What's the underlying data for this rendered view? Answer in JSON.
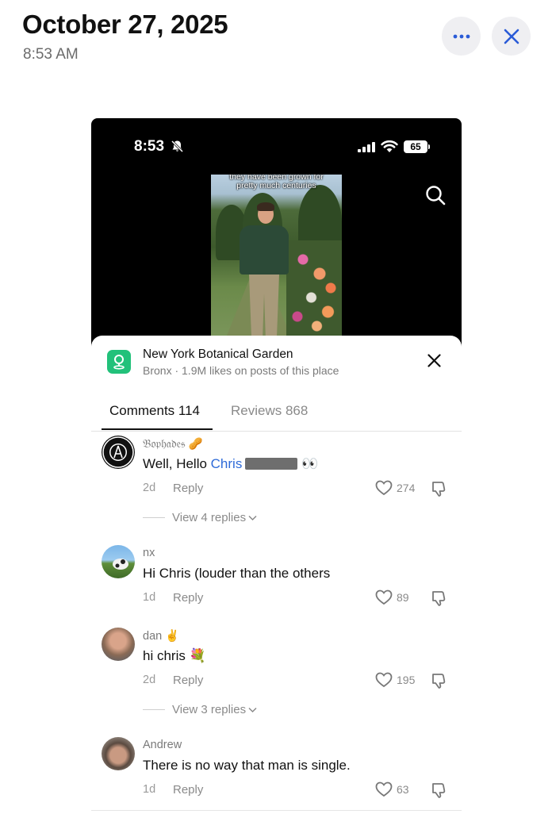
{
  "viewer": {
    "date": "October 27, 2025",
    "time": "8:53 AM"
  },
  "status_bar": {
    "time": "8:53",
    "battery": "65"
  },
  "video": {
    "caption_line1": "they have been grown for",
    "caption_line2": "pretty much centuries"
  },
  "place": {
    "name": "New York Botanical Garden",
    "subtitle": "Bronx · 1.9M likes on posts of this place"
  },
  "tabs": [
    {
      "label": "Comments 114"
    },
    {
      "label": "Reviews 868"
    }
  ],
  "comments": [
    {
      "user": "𝔅𝔬𝔭𝔥𝔞𝔡𝔢𝔰 🥜",
      "text": "Well, Hello ",
      "mention": "Chris",
      "suffix": " 👀",
      "time": "2d",
      "reply": "Reply",
      "likes": "274",
      "view_replies": "View 4 replies"
    },
    {
      "user": "nx",
      "text": "Hi Chris (louder than the others",
      "time": "1d",
      "reply": "Reply",
      "likes": "89"
    },
    {
      "user": "dan ✌️",
      "text": "hi chris 💐",
      "time": "2d",
      "reply": "Reply",
      "likes": "195",
      "view_replies": "View 3 replies"
    },
    {
      "user": "Andrew",
      "text": "There is no way that man is single.",
      "time": "1d",
      "reply": "Reply",
      "likes": "63"
    }
  ]
}
